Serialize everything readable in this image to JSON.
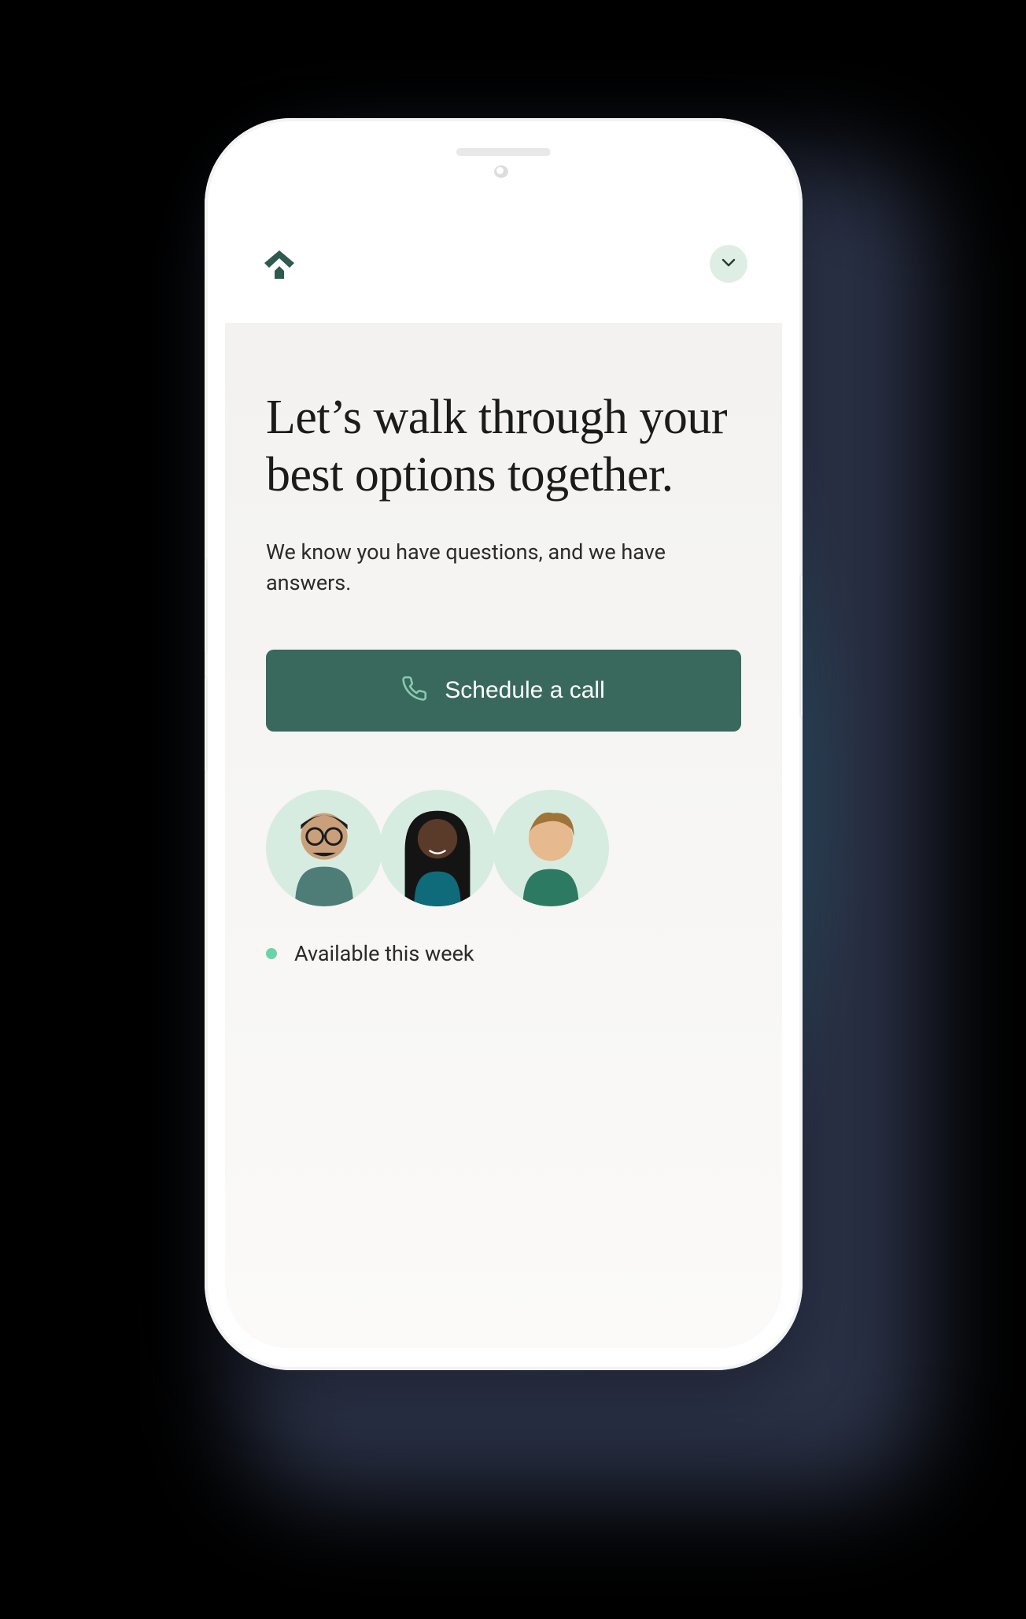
{
  "colors": {
    "brand_dark_green": "#39695d",
    "brand_light_green": "#d7ece0",
    "status_green": "#6bd3a8",
    "glow_cyan": "#00fff0"
  },
  "header": {
    "logo_icon": "house-roof-icon",
    "dropdown_icon": "chevron-down-icon"
  },
  "hero": {
    "headline": "Let’s walk through your best options together.",
    "subhead": "We know you have questions, and we have answers."
  },
  "cta": {
    "icon": "phone-icon",
    "label": "Schedule a call"
  },
  "advisors": {
    "avatars": [
      {
        "name": "advisor-1"
      },
      {
        "name": "advisor-2"
      },
      {
        "name": "advisor-3"
      }
    ],
    "status_text": "Available this week"
  }
}
